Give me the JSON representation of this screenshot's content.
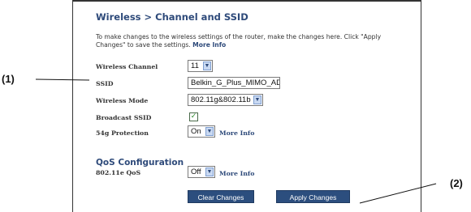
{
  "page": {
    "title": "Wireless > Channel and SSID",
    "instructions_line1": "To make changes to the wireless settings of the router, make the changes here. Click \"Apply",
    "instructions_line2_prefix": "Changes\" to save the settings.",
    "instructions_more_info": "More Info"
  },
  "fields": {
    "wireless_channel": {
      "label": "Wireless Channel",
      "value": "11"
    },
    "ssid": {
      "label": "SSID",
      "value": "Belkin_G_Plus_MIMO_AD"
    },
    "wireless_mode": {
      "label": "Wireless Mode",
      "value": "802.11g&802.11b"
    },
    "broadcast_ssid": {
      "label": "Broadcast SSID",
      "checked": true,
      "check_glyph": "✓"
    },
    "protection_54g": {
      "label": "54g Protection",
      "value": "On",
      "more_info": "More Info"
    }
  },
  "qos": {
    "title": "QoS Configuration",
    "label": "802.11e QoS",
    "value": "Off",
    "more_info": "More Info"
  },
  "buttons": {
    "clear": "Clear Changes",
    "apply": "Apply Changes"
  },
  "callouts": {
    "one": "(1)",
    "two": "(2)"
  },
  "icons": {
    "dropdown": "chevron-down-icon"
  },
  "colors": {
    "heading": "#2e4a7a",
    "button": "#2c4e7e"
  }
}
